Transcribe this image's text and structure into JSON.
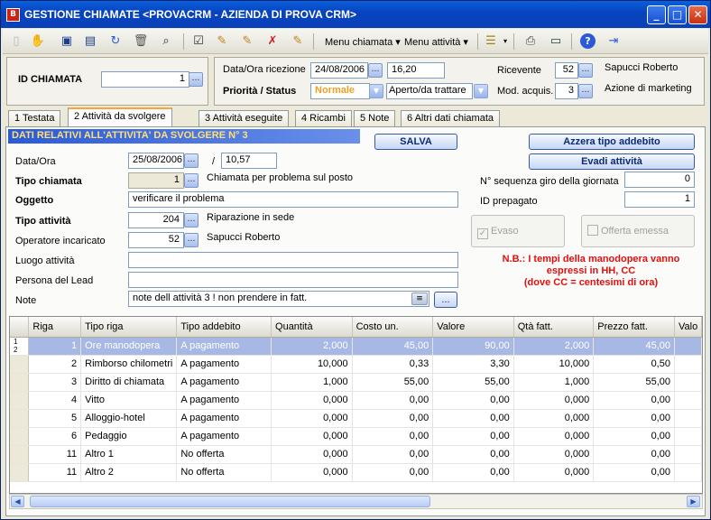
{
  "window": {
    "title": "GESTIONE CHIAMATE <PROVACRM - AZIENDA DI PROVA CRM>",
    "icon_text": "B"
  },
  "toolbar": {
    "menu_chiamata": "Menu chiamata",
    "menu_attivita": "Menu attività"
  },
  "header": {
    "id_label": "ID CHIAMATA",
    "id_value": "1",
    "data_ora_label": "Data/Ora ricezione",
    "data_value": "24/08/2006",
    "ora_value": "16,20",
    "priorita_label": "Priorità / Status",
    "priorita_value": "Normale",
    "status_value": "Aperto/da trattare",
    "ricevente_label": "Ricevente",
    "ricevente_code": "52",
    "ricevente_name": "Sapucci Roberto",
    "mod_label": "Mod. acquis.",
    "mod_code": "3",
    "mod_name": "Azione di marketing"
  },
  "tabs": [
    {
      "label": "1 Testata"
    },
    {
      "label": "2 Attività da svolgere"
    },
    {
      "label": "3 Attività eseguite"
    },
    {
      "label": "4 Ricambi"
    },
    {
      "label": "5 Note"
    },
    {
      "label": "6 Altri dati chiamata"
    }
  ],
  "form": {
    "section_title": "DATI RELATIVI ALL'ATTIVITA' DA SVOLGERE N° 3",
    "salva": "SALVA",
    "azzera": "Azzera tipo addebito",
    "evadi": "Evadi attività",
    "data_ora_label": "Data/Ora",
    "data_value": "25/08/2006",
    "slash": "/",
    "ora_value": "10,57",
    "tipo_chiamata_label": "Tipo chiamata",
    "tipo_chiamata_code": "1",
    "tipo_chiamata_desc": "Chiamata per problema sul posto",
    "oggetto_label": "Oggetto",
    "oggetto_value": "verificare il problema",
    "tipo_attivita_label": "Tipo attività",
    "tipo_attivita_code": "204",
    "tipo_attivita_desc": "Riparazione in sede",
    "operatore_label": "Operatore incaricato",
    "operatore_code": "52",
    "operatore_name": "Sapucci Roberto",
    "luogo_label": "Luogo attività",
    "luogo_value": "",
    "persona_label": "Persona del Lead",
    "persona_value": "",
    "note_label": "Note",
    "note_value": "note dell attività 3 ! non prendere in fatt.",
    "note_btn": "...",
    "sequenza_label": "N° sequenza giro della giornata",
    "sequenza_value": "0",
    "prepagato_label": "ID prepagato",
    "prepagato_value": "1",
    "evaso_label": "Evaso",
    "offerta_label": "Offerta emessa",
    "nb_line1": "N.B.: I tempi della manodopera vanno",
    "nb_line2": "espressi in HH, CC",
    "nb_line3": "(dove CC = centesimi di ora)"
  },
  "grid": {
    "columns": [
      "Riga",
      "Tipo riga",
      "Tipo addebito",
      "Quantità",
      "Costo un.",
      "Valore",
      "Qtà fatt.",
      "Prezzo fatt.",
      "Valo"
    ],
    "indicator": "1\n2",
    "rows": [
      {
        "riga": "1",
        "tipo": "Ore manodopera",
        "addebito": "A pagamento",
        "qta": "2,000",
        "costo": "45,00",
        "valore": "90,00",
        "qtaf": "2,000",
        "prezzo": "45,00"
      },
      {
        "riga": "2",
        "tipo": "Rimborso chilometri",
        "addebito": "A pagamento",
        "qta": "10,000",
        "costo": "0,33",
        "valore": "3,30",
        "qtaf": "10,000",
        "prezzo": "0,50"
      },
      {
        "riga": "3",
        "tipo": "Diritto di chiamata",
        "addebito": "A pagamento",
        "qta": "1,000",
        "costo": "55,00",
        "valore": "55,00",
        "qtaf": "1,000",
        "prezzo": "55,00"
      },
      {
        "riga": "4",
        "tipo": "Vitto",
        "addebito": "A pagamento",
        "qta": "0,000",
        "costo": "0,00",
        "valore": "0,00",
        "qtaf": "0,000",
        "prezzo": "0,00"
      },
      {
        "riga": "5",
        "tipo": "Alloggio-hotel",
        "addebito": "A pagamento",
        "qta": "0,000",
        "costo": "0,00",
        "valore": "0,00",
        "qtaf": "0,000",
        "prezzo": "0,00"
      },
      {
        "riga": "6",
        "tipo": "Pedaggio",
        "addebito": "A pagamento",
        "qta": "0,000",
        "costo": "0,00",
        "valore": "0,00",
        "qtaf": "0,000",
        "prezzo": "0,00"
      },
      {
        "riga": "11",
        "tipo": "Altro 1",
        "addebito": "No offerta",
        "qta": "0,000",
        "costo": "0,00",
        "valore": "0,00",
        "qtaf": "0,000",
        "prezzo": "0,00"
      },
      {
        "riga": "11",
        "tipo": "Altro 2",
        "addebito": "No offerta",
        "qta": "0,000",
        "costo": "0,00",
        "valore": "0,00",
        "qtaf": "0,000",
        "prezzo": "0,00"
      }
    ]
  },
  "colors": {
    "accent": "#0a246a",
    "priority": "#f0a020",
    "nb": "#e01010",
    "section_bar": "#2a5ad8"
  }
}
